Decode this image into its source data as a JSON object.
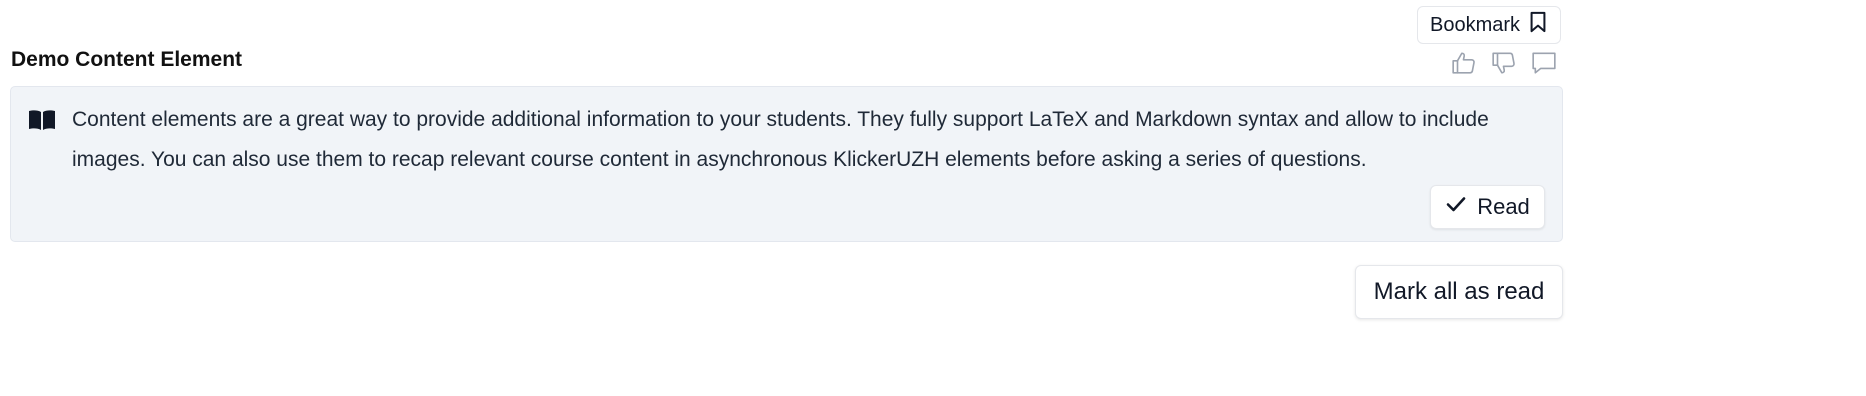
{
  "header": {
    "bookmark_label": "Bookmark",
    "bookmark_icon": "bookmark-icon"
  },
  "element": {
    "title": "Demo Content Element",
    "feedback_icons": [
      "thumbs-up-icon",
      "thumbs-down-icon",
      "comment-icon"
    ],
    "content_icon": "book-open-icon",
    "content_text": "Content elements are a great way to provide additional information to your students. They fully support LaTeX and Markdown syntax and allow to include images. You can also use them to recap relevant course content in asynchronous KlickerUZH elements before asking a series of questions.",
    "read_label": "Read",
    "read_icon": "check-icon"
  },
  "footer": {
    "mark_all_label": "Mark all as read"
  },
  "colors": {
    "card_background": "#f1f4f8",
    "card_border": "#e3e7ee",
    "icon_muted": "#9ca3af",
    "text": "#1f2937"
  }
}
